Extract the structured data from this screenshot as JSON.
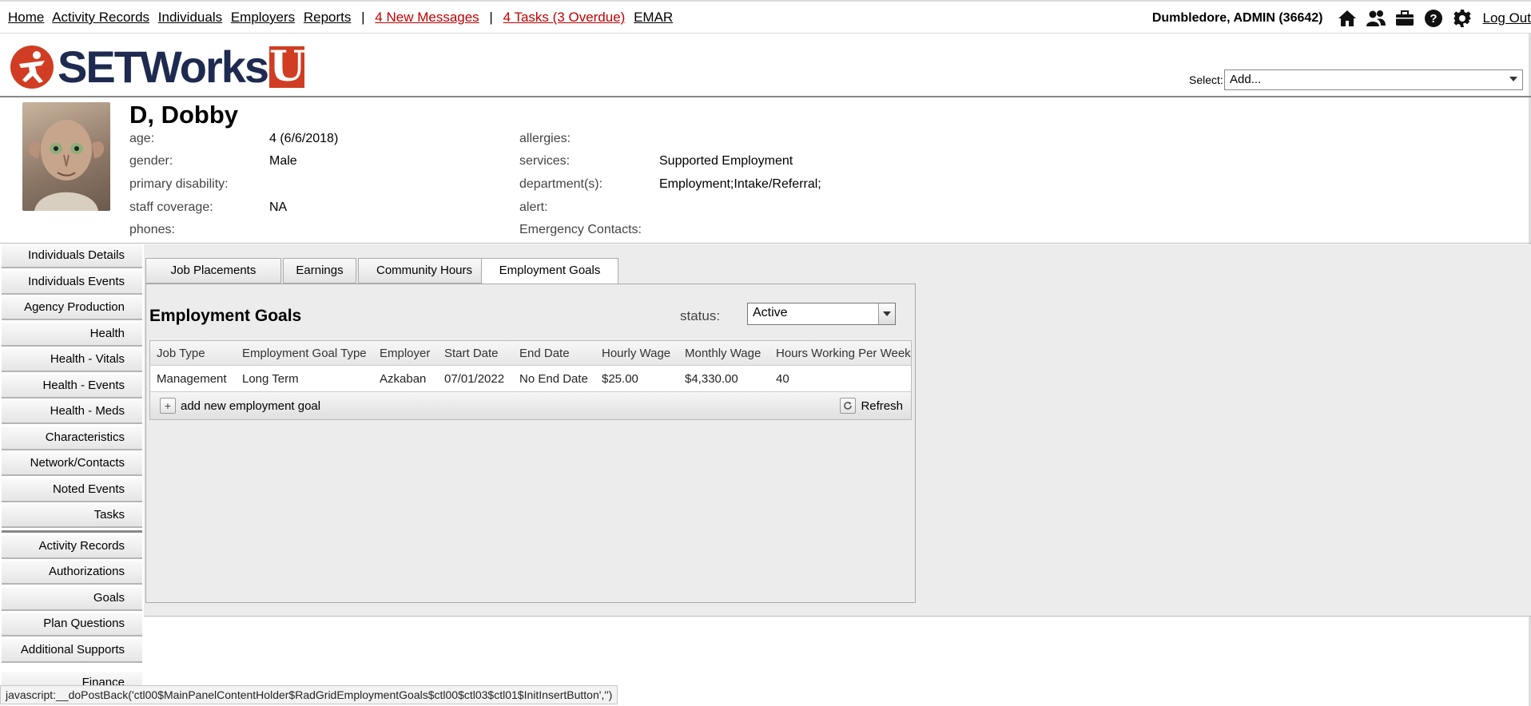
{
  "topnav": {
    "links": [
      "Home",
      "Activity Records",
      "Individuals",
      "Employers",
      "Reports"
    ],
    "separator": "|",
    "messages": "4 New Messages",
    "tasks": "4 Tasks (3 Overdue)",
    "emar": "EMAR",
    "user": "Dumbledore, ADMIN  (36642)",
    "logout": "Log Out",
    "icons": [
      "home-icon",
      "people-icon",
      "briefcase-icon",
      "help-icon",
      "gear-icon"
    ]
  },
  "header": {
    "logo_main": "SETWorks",
    "logo_u": "U",
    "select_label": "Select:",
    "select_value": "Add..."
  },
  "person": {
    "name": "D, Dobby",
    "left": [
      {
        "label": "age:",
        "value": "4 (6/6/2018)"
      },
      {
        "label": "gender:",
        "value": "Male"
      },
      {
        "label": "primary disability:",
        "value": ""
      },
      {
        "label": "staff coverage:",
        "value": "NA"
      },
      {
        "label": "phones:",
        "value": ""
      }
    ],
    "right": [
      {
        "label": "allergies:",
        "value": ""
      },
      {
        "label": "services:",
        "value": "Supported Employment"
      },
      {
        "label": "department(s):",
        "value": "Employment;Intake/Referral;"
      },
      {
        "label": "alert:",
        "value": ""
      },
      {
        "label": "Emergency Contacts:",
        "value": ""
      }
    ]
  },
  "sidebar": {
    "group1": [
      "Individuals Details",
      "Individuals Events",
      "Agency Production",
      "Health",
      "Health - Vitals",
      "Health - Events",
      "Health - Meds",
      "Characteristics",
      "Network/Contacts",
      "Noted Events",
      "Tasks"
    ],
    "group2": [
      "Activity Records",
      "Authorizations",
      "Goals",
      "Plan Questions",
      "Additional Supports",
      "Finance"
    ]
  },
  "tabs": [
    "Job Placements",
    "Earnings",
    "Community Hours",
    "Employment Goals"
  ],
  "active_tab": "Employment Goals",
  "panel": {
    "title": "Employment Goals",
    "status_label": "status:",
    "status_value": "Active"
  },
  "grid": {
    "columns": [
      "Job Type",
      "Employment Goal Type",
      "Employer",
      "Start Date",
      "End Date",
      "Hourly Wage",
      "Monthly Wage",
      "Hours Working Per Week"
    ],
    "rows": [
      [
        "Management",
        "Long Term",
        "Azkaban",
        "07/01/2022",
        "No End Date",
        "$25.00",
        "$4,330.00",
        "40"
      ]
    ],
    "add_label": "add new employment goal",
    "refresh_label": "Refresh"
  },
  "statusbar": "javascript:__doPostBack('ctl00$MainPanelContentHolder$RadGridEmploymentGoals$ctl00$ctl03$ctl01$InitInsertButton','')",
  "colors": {
    "brand_navy": "#1e2a4f",
    "brand_red": "#d03d22",
    "link_red": "#c00000"
  }
}
